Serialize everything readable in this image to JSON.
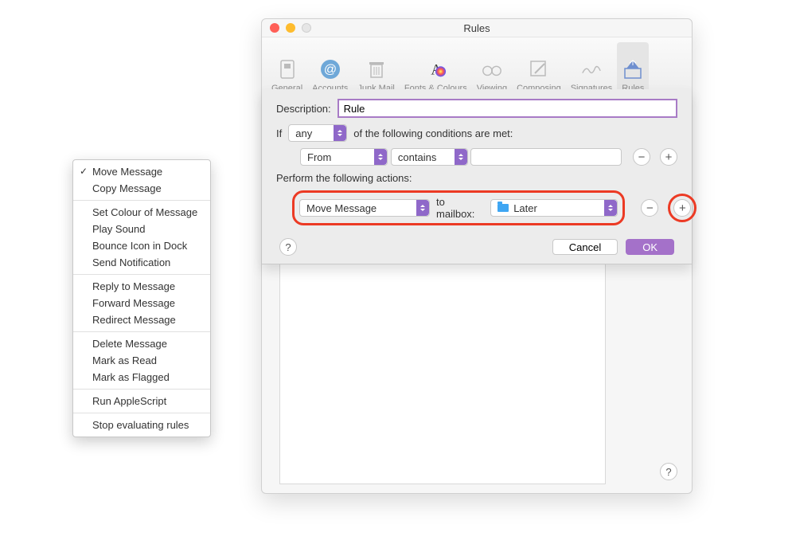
{
  "window": {
    "title": "Rules",
    "traffic": {
      "close": "close",
      "min": "min",
      "zoom": "zoom"
    }
  },
  "toolbar": {
    "general": "General",
    "accounts": "Accounts",
    "junk": "Junk Mail",
    "fonts": "Fonts & Colours",
    "viewing": "Viewing",
    "composing": "Composing",
    "signatures": "Signatures",
    "rules": "Rules"
  },
  "sheet": {
    "description_label": "Description:",
    "description_value": "Rule",
    "if_label": "If",
    "match_mode": "any",
    "if_tail": "of the following conditions are met:",
    "cond_field": "From",
    "cond_op": "contains",
    "cond_value": "",
    "perform_label": "Perform the following actions:",
    "action": "Move Message",
    "to_mailbox_label": "to mailbox:",
    "mailbox": "Later",
    "minus": "−",
    "plus": "+",
    "ok": "OK",
    "cancel": "Cancel",
    "help": "?"
  },
  "menu": {
    "items": [
      [
        {
          "label": "Move Message",
          "checked": true
        },
        {
          "label": "Copy Message"
        }
      ],
      [
        {
          "label": "Set Colour of Message"
        },
        {
          "label": "Play Sound"
        },
        {
          "label": "Bounce Icon in Dock"
        },
        {
          "label": "Send Notification"
        }
      ],
      [
        {
          "label": "Reply to Message"
        },
        {
          "label": "Forward Message"
        },
        {
          "label": "Redirect Message"
        }
      ],
      [
        {
          "label": "Delete Message"
        },
        {
          "label": "Mark as Read"
        },
        {
          "label": "Mark as Flagged"
        }
      ],
      [
        {
          "label": "Run AppleScript"
        }
      ],
      [
        {
          "label": "Stop evaluating rules"
        }
      ]
    ]
  },
  "help_corner": "?"
}
